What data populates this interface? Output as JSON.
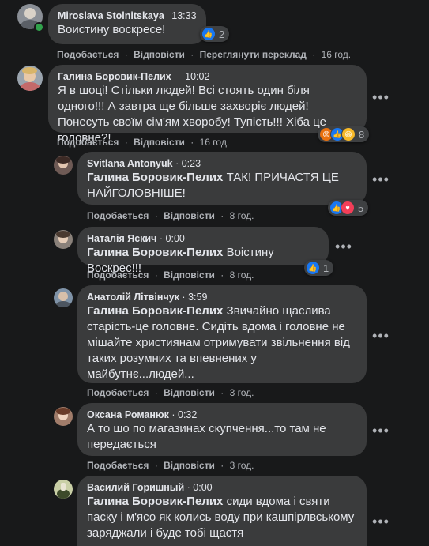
{
  "actions": {
    "like": "Подобається",
    "reply": "Відповісти",
    "see_translation": "Переглянути переклад",
    "sep": "·"
  },
  "colors": {
    "page_bg": "#18191a",
    "bubble_bg": "#3a3b3c",
    "like_blue": "#1877f2",
    "haha_yellow": "#f7b928",
    "angry_orange": "#e9710f",
    "love_red": "#f33e58",
    "online_green": "#31a24c"
  },
  "comments": [
    {
      "author": "Miroslava Stolnitskaya",
      "time": "13:33",
      "text": "Воистину воскресе!",
      "age": "16 год.",
      "reactions": [
        "like-icon"
      ],
      "reaction_count": "2"
    },
    {
      "author": "Галина Боровик-Пелих",
      "time": "10:02",
      "text": "Я в шоці! Стільки людей! Всі стоять один біля одного!!! А завтра ще більше захворіє людей! Понесуть своїм сім'ям хворобу! Тупість!!! Хіба це головне?!",
      "age": "16 год.",
      "reactions": [
        "angry-icon",
        "like-icon",
        "haha-icon"
      ],
      "reaction_count": "8"
    },
    {
      "author": "Svitlana Antonyuk",
      "time": "0:23",
      "tag": "Галина Боровик-Пелих",
      "text": "ТАК! ПРИЧАСТЯ ЦЕ НАЙГОЛОВНІШЕ!",
      "age": "8 год.",
      "reactions": [
        "like-icon",
        "love-icon"
      ],
      "reaction_count": "5"
    },
    {
      "author": "Наталія Яскич",
      "time": "0:00",
      "tag": "Галина Боровик-Пелих",
      "text": "Воістину Воскрес!!!",
      "age": "8 год.",
      "reactions": [
        "like-icon"
      ],
      "reaction_count": "1"
    },
    {
      "author": "Анатолій Літвінчук",
      "time": "3:59",
      "tag": "Галина Боровик-Пелих",
      "text": "Звичайно щаслива старість-це головне. Сидіть вдома і головне не мішайте християнам отримувати звільнення від таких розумних та впевнених у майбутнє...людей...",
      "age": "3 год."
    },
    {
      "author": "Оксана Романюк",
      "time": "0:32",
      "text": "А то шо по магазинах скупчення...то там не передається",
      "age": "3 год."
    },
    {
      "author": "Василий Горишный",
      "time": "0:00",
      "tag": "Галина Боровик-Пелих",
      "text": "сиди вдома і святи паску і м'ясо як колись воду при кашпірлвському заряджали і буде тобі щастя"
    }
  ]
}
